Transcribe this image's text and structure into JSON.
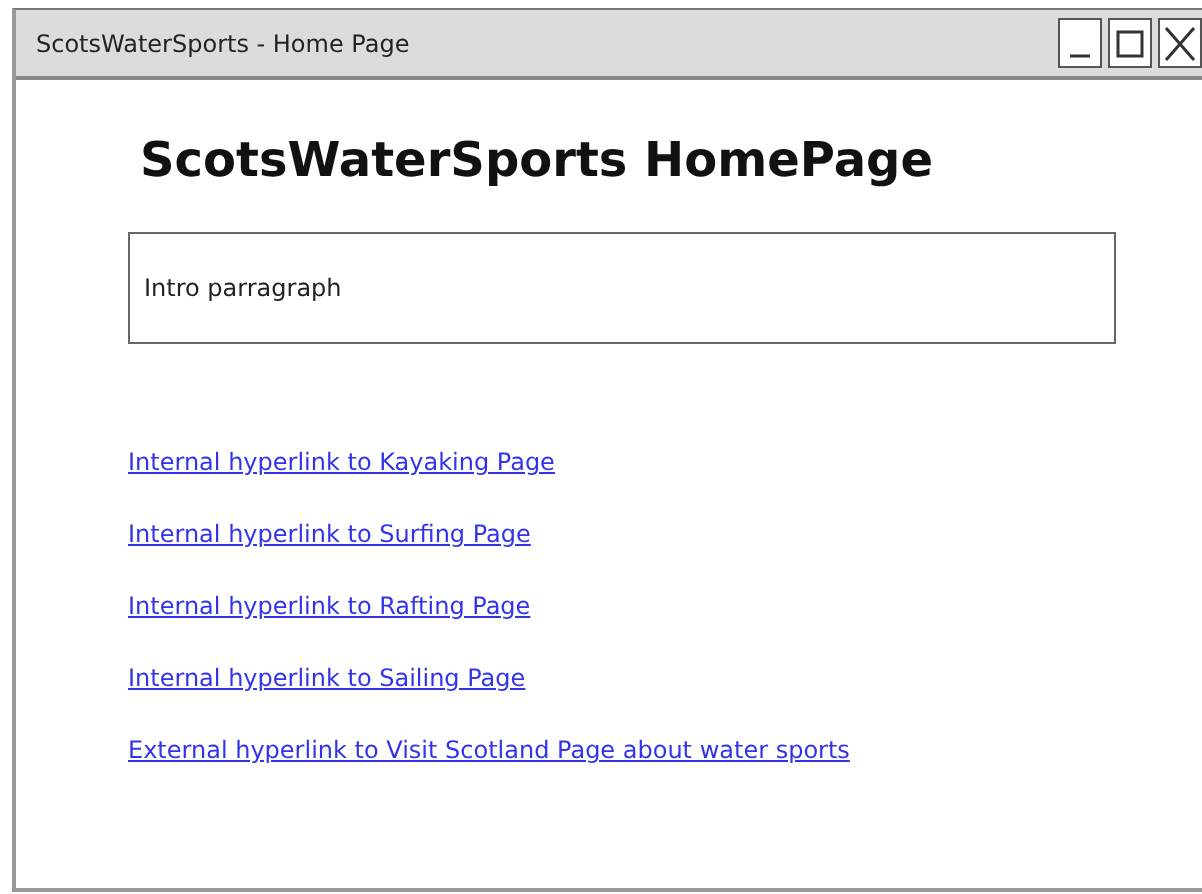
{
  "window": {
    "title": "ScotsWaterSports - Home Page"
  },
  "heading": "ScotsWaterSports HomePage",
  "intro": {
    "text": "Intro parragraph"
  },
  "links": [
    {
      "label": "Internal hyperlink to Kayaking Page"
    },
    {
      "label": "Internal hyperlink to Surfing Page"
    },
    {
      "label": "Internal hyperlink to Rafting Page"
    },
    {
      "label": "Internal hyperlink to Sailing Page"
    },
    {
      "label": "External hyperlink to Visit Scotland Page about water sports"
    }
  ]
}
